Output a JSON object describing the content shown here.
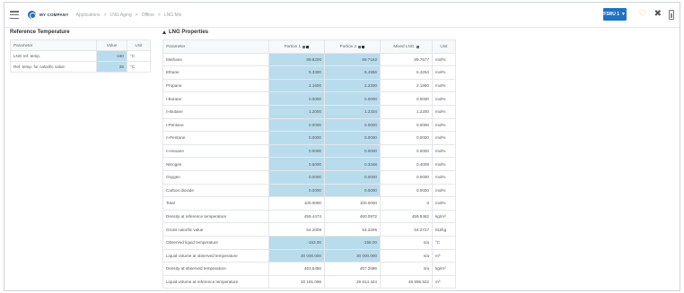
{
  "topbar": {
    "company": "MY COMPANY",
    "breadcrumb": [
      "Applications",
      "LNG Aging",
      "Offline",
      "LNG Mix"
    ],
    "separator": ">",
    "fsru_label": "FSRU 1",
    "accent": "#1f73c4"
  },
  "reference": {
    "title": "Reference Temperature",
    "headers": {
      "parameter": "Parameter",
      "value": "Value",
      "unit": "Unit"
    },
    "rows": [
      {
        "parameter": "LNG ref. temp.",
        "value": "-160",
        "unit": "°C"
      },
      {
        "parameter": "Ref. temp. for calorific value",
        "value": "25",
        "unit": "°C"
      }
    ]
  },
  "lng": {
    "title": "LNG Properties",
    "headers": {
      "parameter": "Parameter",
      "portion1": "Portion 1",
      "portion2": "Portion 2",
      "mixed": "Mixed LNG",
      "unit": "Unit"
    },
    "rows": [
      {
        "parameter": "Methane",
        "p1": "89.8200",
        "p2": "89.7162",
        "mixed": "89.7577",
        "unit": "mol%"
      },
      {
        "parameter": "Ethane",
        "p1": "6.3300",
        "p2": "6.4956",
        "mixed": "6.4254",
        "unit": "mol%"
      },
      {
        "parameter": "Propane",
        "p1": "2.1600",
        "p2": "2.2200",
        "mixed": "2.1960",
        "unit": "mol%"
      },
      {
        "parameter": "i-Butane",
        "p1": "0.0000",
        "p2": "0.0000",
        "mixed": "0.0000",
        "unit": "mol%"
      },
      {
        "parameter": "n-Butane",
        "p1": "1.2000",
        "p2": "1.2334",
        "mixed": "1.2200",
        "unit": "mol%"
      },
      {
        "parameter": "i-Pentane",
        "p1": "0.0000",
        "p2": "0.0000",
        "mixed": "0.0000",
        "unit": "mol%"
      },
      {
        "parameter": "n-Pentane",
        "p1": "0.0000",
        "p2": "0.0000",
        "mixed": "0.0000",
        "unit": "mol%"
      },
      {
        "parameter": "n-Hexane",
        "p1": "0.0000",
        "p2": "0.0000",
        "mixed": "0.0000",
        "unit": "mol%"
      },
      {
        "parameter": "Nitrogen",
        "p1": "0.5000",
        "p2": "0.3348",
        "mixed": "0.4009",
        "unit": "mol%"
      },
      {
        "parameter": "Oxygen",
        "p1": "0.0000",
        "p2": "0.0000",
        "mixed": "0.0000",
        "unit": "mol%"
      },
      {
        "parameter": "Carbon dioxide",
        "p1": "0.0000",
        "p2": "0.0000",
        "mixed": "0.0000",
        "unit": "mol%"
      },
      {
        "parameter": "Total",
        "p1": "100.0000",
        "p2": "100.0000",
        "mixed": "0",
        "unit": "mol%"
      },
      {
        "parameter": "Density at reference temperature",
        "p1": "459.4474",
        "p2": "460.0972",
        "mixed": "459.8462",
        "unit": "kg/m³"
      },
      {
        "parameter": "Gross calorific value",
        "p1": "54.2008",
        "p2": "54.3205",
        "mixed": "54.2727",
        "unit": "MJ/kg"
      },
      {
        "parameter": "Observed liquid temperature",
        "p1": "-163.00",
        "p2": "-158.00",
        "mixed": "n/a",
        "unit": "°C"
      },
      {
        "parameter": "Liquid volume at observed temperature",
        "p1": "20 000.000",
        "p2": "30 000.000",
        "mixed": "n/a",
        "unit": "m³"
      },
      {
        "parameter": "Density at observed temperature",
        "p1": "463.6456",
        "p2": "457.2686",
        "mixed": "n/a",
        "unit": "kg/m³"
      },
      {
        "parameter": "Liquid volume at reference temperature",
        "p1": "20 181.098",
        "p2": "29 814.424",
        "mixed": "49 995.522",
        "unit": "m³"
      }
    ]
  }
}
